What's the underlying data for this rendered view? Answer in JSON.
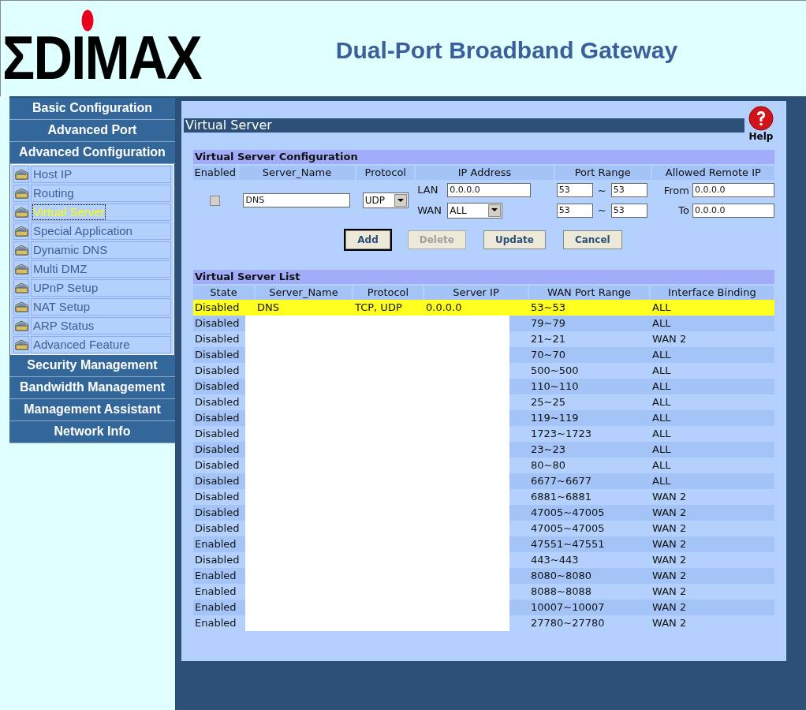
{
  "header": {
    "logo": "ΣDIMAX",
    "title": "Dual-Port Broadband Gateway"
  },
  "sidebar": {
    "items": [
      {
        "label": "Basic Configuration"
      },
      {
        "label": "Advanced Port"
      },
      {
        "label": "Advanced Configuration",
        "children": [
          {
            "label": "Host IP",
            "selected": false
          },
          {
            "label": "Routing",
            "selected": false
          },
          {
            "label": "Virtual Server",
            "selected": true
          },
          {
            "label": "Special Application",
            "selected": false
          },
          {
            "label": "Dynamic DNS",
            "selected": false
          },
          {
            "label": "Multi DMZ",
            "selected": false
          },
          {
            "label": "UPnP Setup",
            "selected": false
          },
          {
            "label": "NAT Setup",
            "selected": false
          },
          {
            "label": "ARP Status",
            "selected": false
          },
          {
            "label": "Advanced Feature",
            "selected": false
          }
        ]
      },
      {
        "label": "Security Management"
      },
      {
        "label": "Bandwidth Management"
      },
      {
        "label": "Management Assistant"
      },
      {
        "label": "Network Info"
      }
    ]
  },
  "page_title": "Virtual Server",
  "help_label": "Help",
  "config": {
    "title": "Virtual Server Configuration",
    "columns": [
      "Enabled",
      "Server_Name",
      "Protocol",
      "IP Address",
      "Port Range",
      "Allowed Remote IP"
    ],
    "enabled": false,
    "server_name": "DNS",
    "protocol": "UDP",
    "lan_label": "LAN",
    "lan_ip": "0.0.0.0",
    "wan_label": "WAN",
    "wan": "ALL",
    "ports": [
      {
        "from": "53",
        "sep": "~",
        "to": "53"
      },
      {
        "from": "53",
        "sep": "~",
        "to": "53"
      }
    ],
    "remote": [
      {
        "label": "From",
        "value": "0.0.0.0"
      },
      {
        "label": "To",
        "value": "0.0.0.0"
      }
    ],
    "buttons": [
      {
        "label": "Add",
        "disabled": false,
        "focused": true
      },
      {
        "label": "Delete",
        "disabled": true,
        "focused": false
      },
      {
        "label": "Update",
        "disabled": false,
        "focused": false
      },
      {
        "label": "Cancel",
        "disabled": false,
        "focused": false
      }
    ]
  },
  "list": {
    "title": "Virtual Server List",
    "columns": [
      "State",
      "Server_Name",
      "Protocol",
      "Server IP",
      "WAN Port Range",
      "Interface Binding"
    ],
    "rows": [
      {
        "state": "Disabled",
        "name": "DNS",
        "protocol": "TCP, UDP",
        "server_ip": "0.0.0.0",
        "wan_ports": "53~53",
        "binding": "ALL",
        "selected": true
      },
      {
        "state": "Disabled",
        "wan_ports": "79~79",
        "binding": "ALL",
        "selected": false
      },
      {
        "state": "Disabled",
        "wan_ports": "21~21",
        "binding": "WAN 2",
        "selected": false
      },
      {
        "state": "Disabled",
        "wan_ports": "70~70",
        "binding": "ALL",
        "selected": false
      },
      {
        "state": "Disabled",
        "wan_ports": "500~500",
        "binding": "ALL",
        "selected": false
      },
      {
        "state": "Disabled",
        "wan_ports": "110~110",
        "binding": "ALL",
        "selected": false
      },
      {
        "state": "Disabled",
        "wan_ports": "25~25",
        "binding": "ALL",
        "selected": false
      },
      {
        "state": "Disabled",
        "wan_ports": "119~119",
        "binding": "ALL",
        "selected": false
      },
      {
        "state": "Disabled",
        "wan_ports": "1723~1723",
        "binding": "ALL",
        "selected": false
      },
      {
        "state": "Disabled",
        "wan_ports": "23~23",
        "binding": "ALL",
        "selected": false
      },
      {
        "state": "Disabled",
        "wan_ports": "80~80",
        "binding": "ALL",
        "selected": false
      },
      {
        "state": "Disabled",
        "wan_ports": "6677~6677",
        "binding": "ALL",
        "selected": false
      },
      {
        "state": "Disabled",
        "wan_ports": "6881~6881",
        "binding": "WAN 2",
        "selected": false
      },
      {
        "state": "Disabled",
        "wan_ports": "47005~47005",
        "binding": "WAN 2",
        "selected": false
      },
      {
        "state": "Disabled",
        "wan_ports": "47005~47005",
        "binding": "WAN 2",
        "selected": false
      },
      {
        "state": "Enabled",
        "wan_ports": "47551~47551",
        "binding": "WAN 2",
        "selected": false
      },
      {
        "state": "Disabled",
        "wan_ports": "443~443",
        "binding": "WAN 2",
        "selected": false
      },
      {
        "state": "Enabled",
        "wan_ports": "8080~8080",
        "binding": "WAN 2",
        "selected": false
      },
      {
        "state": "Enabled",
        "wan_ports": "8088~8088",
        "binding": "WAN 2",
        "selected": false
      },
      {
        "state": "Enabled",
        "wan_ports": "10007~10007",
        "binding": "WAN 2",
        "selected": false
      },
      {
        "state": "Enabled",
        "wan_ports": "27780~27780",
        "binding": "WAN 2",
        "selected": false
      }
    ]
  }
}
